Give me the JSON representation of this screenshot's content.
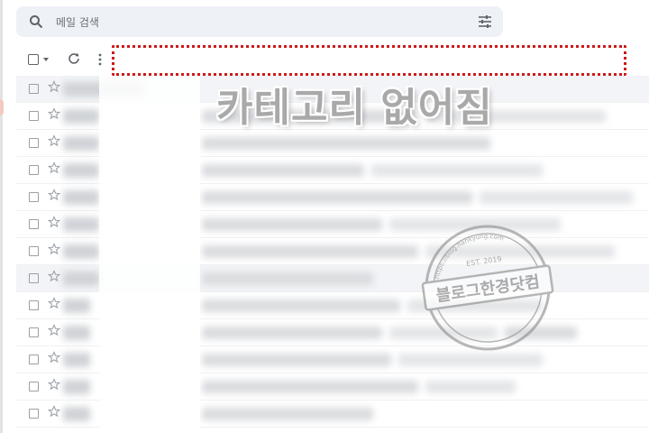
{
  "search": {
    "placeholder": "메일 검색",
    "icon": "search-icon",
    "options_icon": "tune-icon"
  },
  "toolbar": {
    "select_icon": "checkbox-icon",
    "select_menu_icon": "caret-down-icon",
    "refresh_icon": "refresh-icon",
    "more_icon": "more-vert-icon"
  },
  "annotation": {
    "caption": "카테고리 없어짐",
    "highlight_color": "#cc1a1a"
  },
  "watermark": {
    "main": "블로그한경닷컴",
    "url": "https://blog.hankyung.com",
    "est": "EST. 2019"
  },
  "rows": [
    {
      "s": 90,
      "a": 0,
      "b": 0,
      "c": 0,
      "alt": true
    },
    {
      "s": 40,
      "a": 240,
      "b": 200,
      "c": 0,
      "alt": false
    },
    {
      "s": 40,
      "a": 320,
      "b": 0,
      "c": 0,
      "alt": false
    },
    {
      "s": 40,
      "a": 180,
      "b": 190,
      "c": 0,
      "alt": false
    },
    {
      "s": 40,
      "a": 300,
      "b": 170,
      "c": 0,
      "alt": false
    },
    {
      "s": 40,
      "a": 200,
      "b": 190,
      "c": 0,
      "alt": false
    },
    {
      "s": 40,
      "a": 240,
      "b": 210,
      "c": 0,
      "alt": false
    },
    {
      "s": 40,
      "a": 190,
      "b": 0,
      "c": 0,
      "alt": true
    },
    {
      "s": 30,
      "a": 220,
      "b": 150,
      "c": 0,
      "alt": false
    },
    {
      "s": 30,
      "a": 200,
      "b": 120,
      "c": 80,
      "alt": false
    },
    {
      "s": 30,
      "a": 210,
      "b": 160,
      "c": 0,
      "alt": false
    },
    {
      "s": 30,
      "a": 240,
      "b": 100,
      "c": 0,
      "alt": false
    },
    {
      "s": 30,
      "a": 190,
      "b": 0,
      "c": 0,
      "alt": false
    }
  ]
}
